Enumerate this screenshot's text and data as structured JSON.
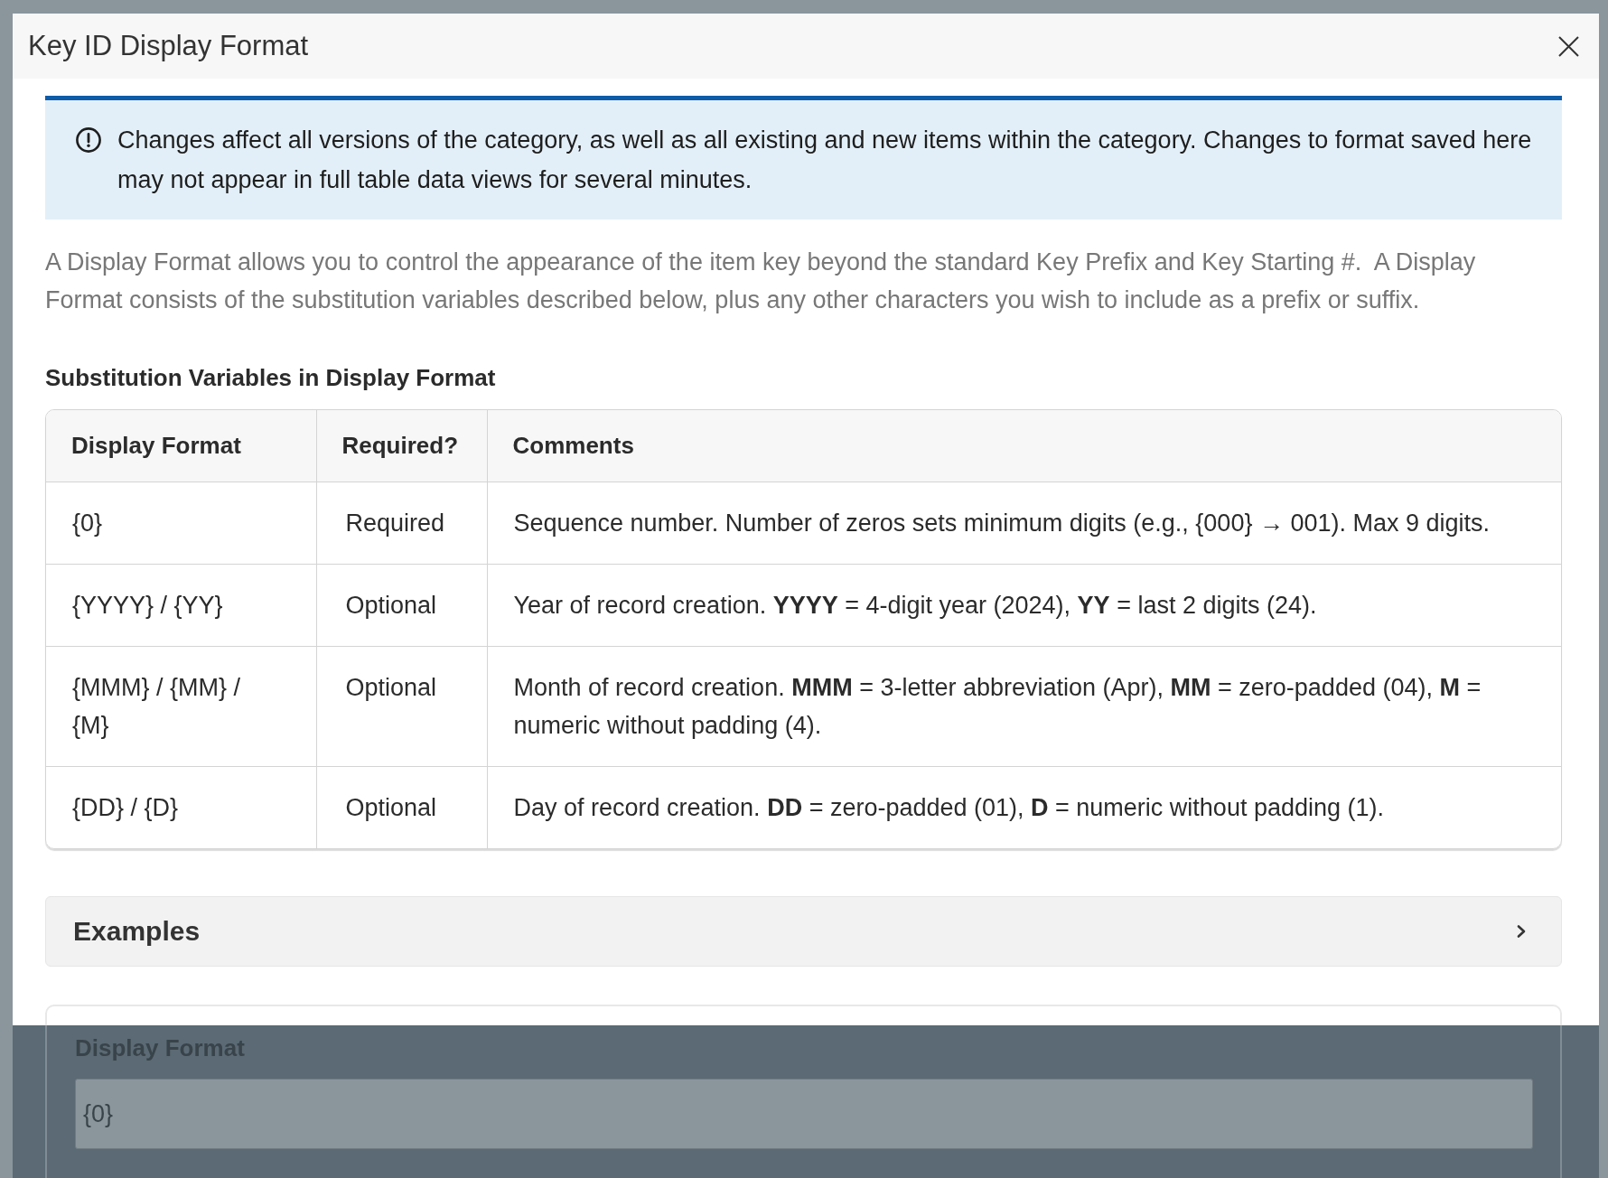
{
  "dialog": {
    "title": "Key ID Display Format"
  },
  "alert": {
    "text": "Changes affect all versions of the category, as well as all existing and new items within the category. Changes to format saved here may not appear in full table data views for several minutes."
  },
  "description": "A Display Format allows you to control the appearance of the item key beyond the standard Key Prefix and Key Starting #.  A Display Format consists of the substitution variables described below, plus any other characters you wish to include as a prefix or suffix.",
  "section_title": "Substitution Variables in Display Format",
  "table": {
    "columns": [
      "Display Format",
      "Required?",
      "Comments"
    ],
    "rows": [
      {
        "cells": [
          "{0}",
          "Required",
          "Sequence number. Number of zeros sets minimum digits (e.g., {000} → 001). Max 9 digits."
        ]
      },
      {
        "cells": [
          "{YYYY} / {YY}",
          "Optional",
          "Year of record creation. **YYYY** = 4-digit year (2024), **YY** = last 2 digits (24)."
        ]
      },
      {
        "cells": [
          "{MMM} / {MM} / {M}",
          "Optional",
          "Month of record creation. **MMM** = 3-letter abbreviation (Apr), **MM** = zero-padded (04), **M** = numeric without padding (4)."
        ]
      },
      {
        "cells": [
          "{DD} / {D}",
          "Optional",
          "Day of record creation. **DD** = zero-padded (01), **D** = numeric without padding (1)."
        ]
      }
    ]
  },
  "examples": {
    "title": "Examples",
    "expanded": false
  },
  "format_field": {
    "label": "Display Format",
    "value": "{0}"
  }
}
